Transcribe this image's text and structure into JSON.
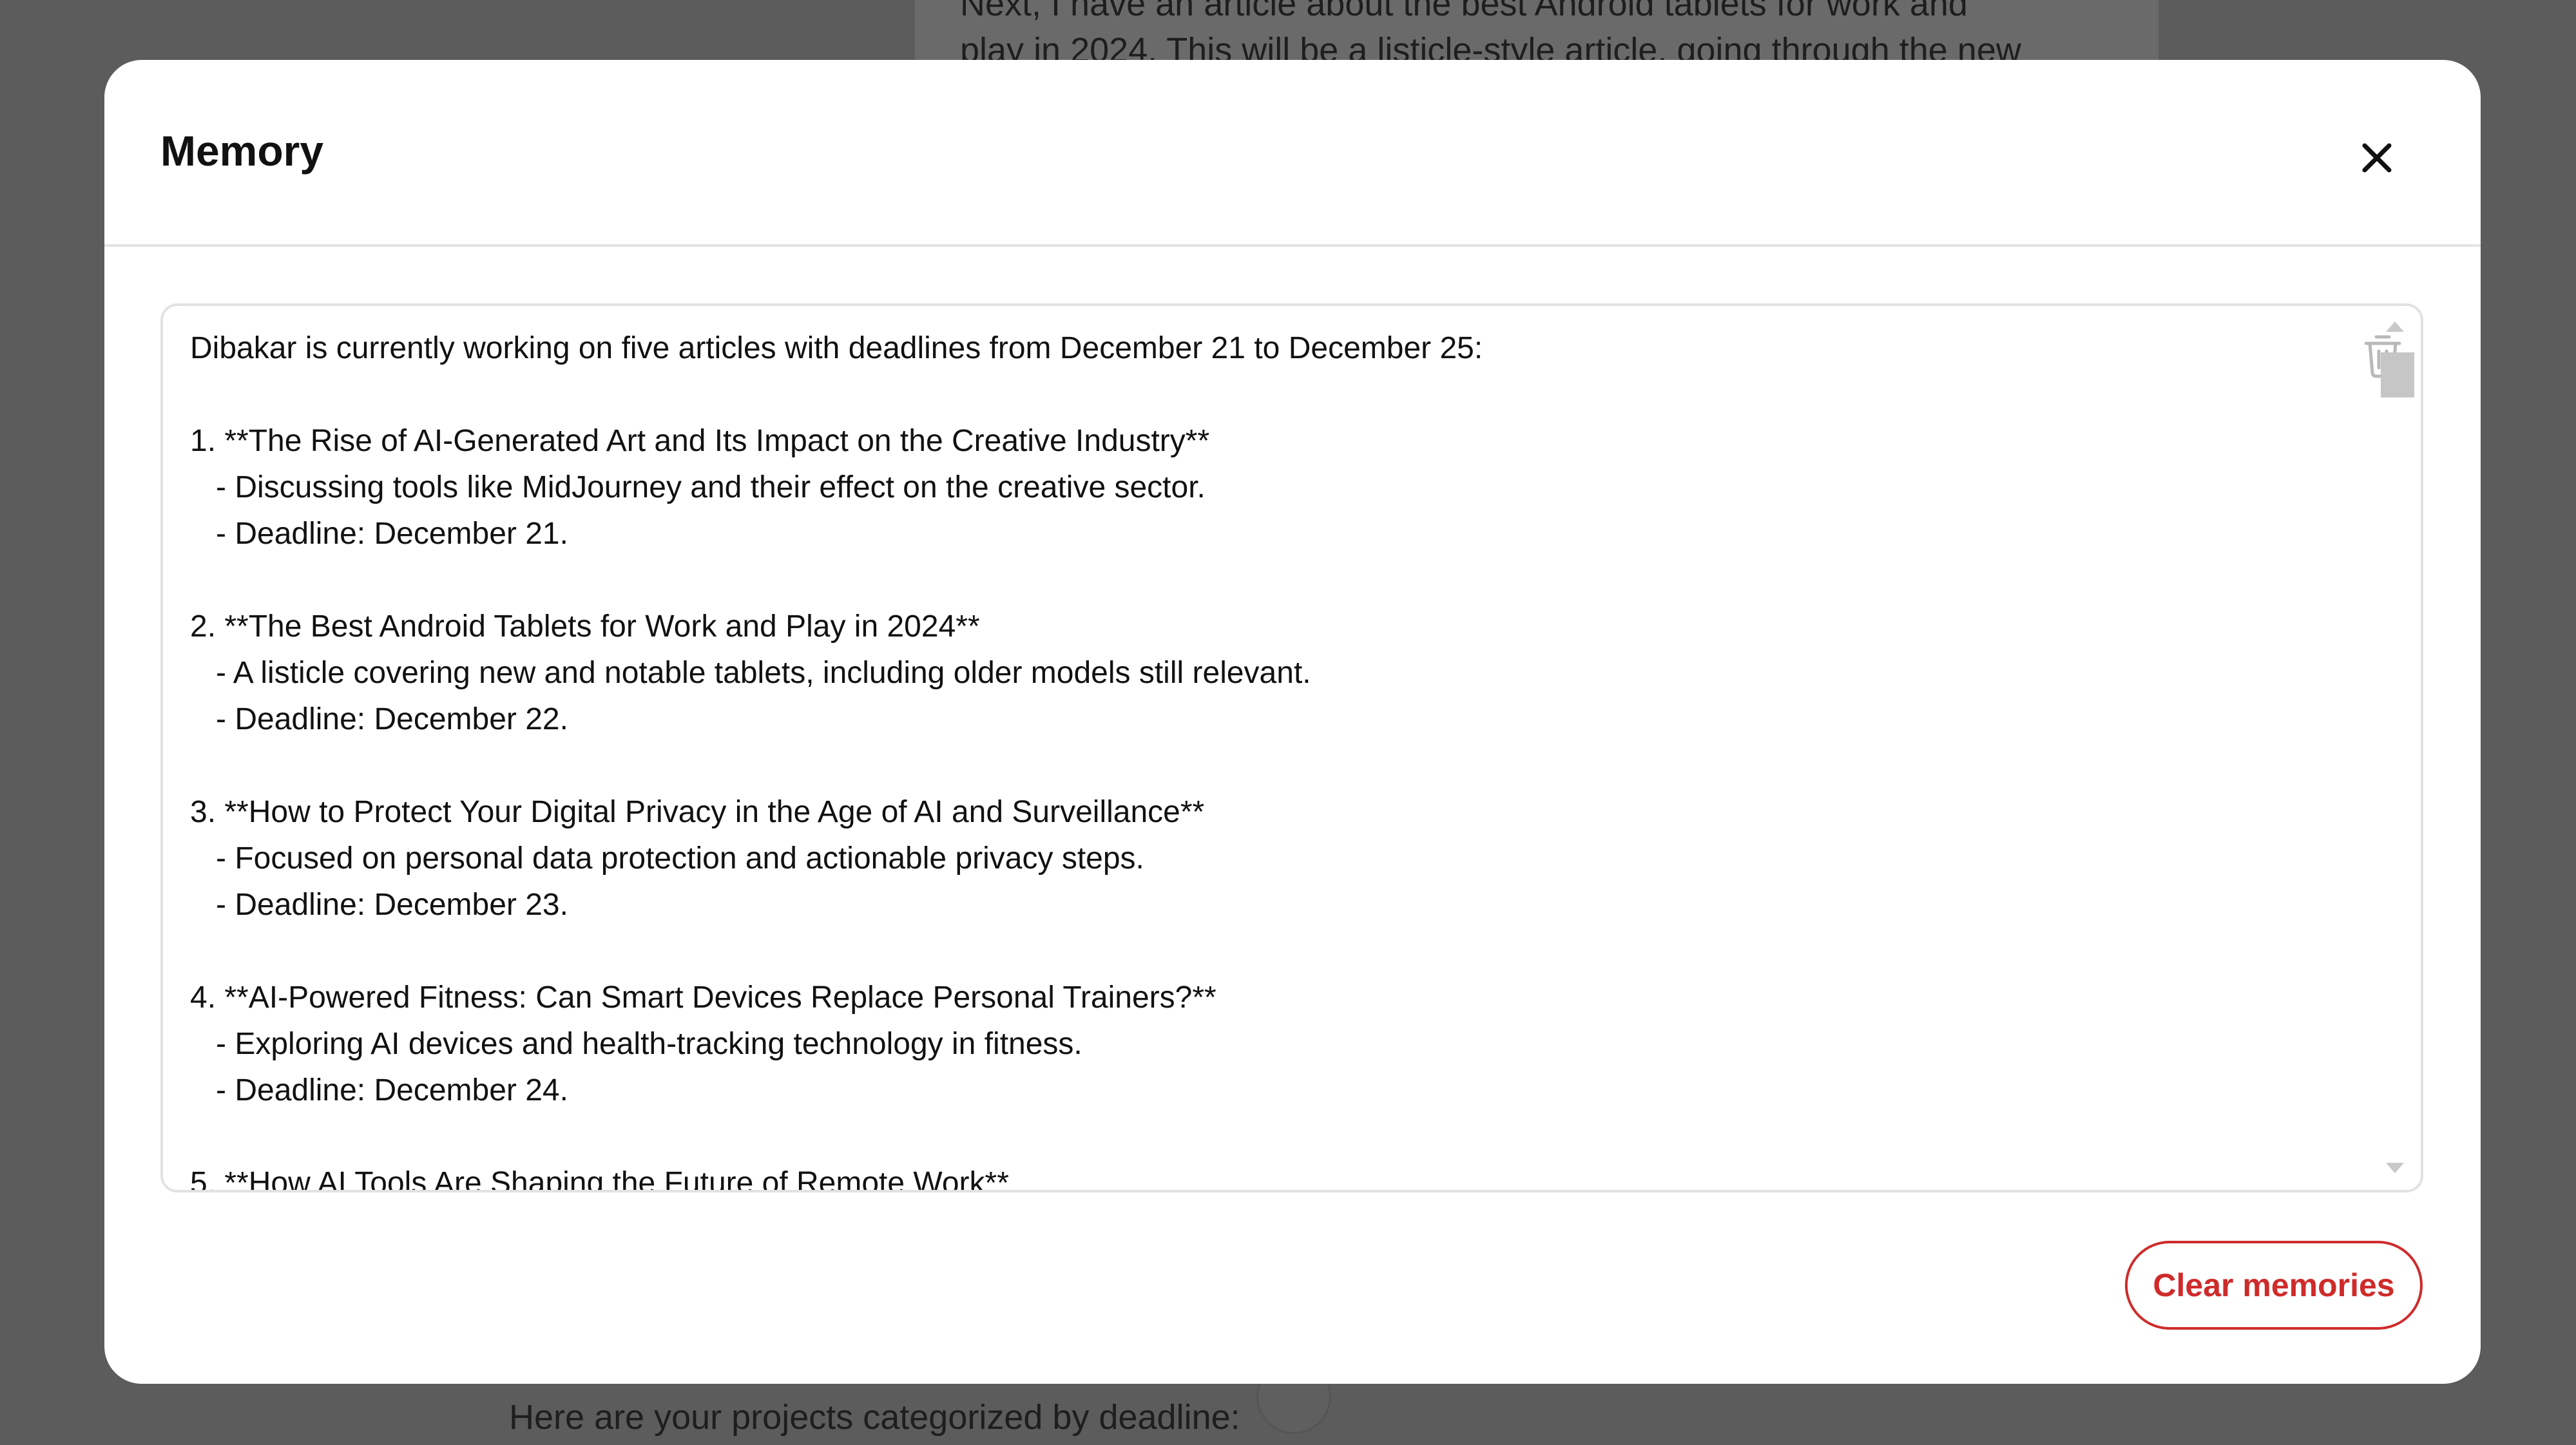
{
  "background": {
    "top_text": "Next, I have an article about the best Android tablets for work and\nplay in 2024. This will be a listicle-style article, going through the new",
    "bottom_text": "Here are your projects categorized by deadline:"
  },
  "modal": {
    "title": "Memory",
    "close_icon": "close-icon",
    "memory_text": "Dibakar is currently working on five articles with deadlines from December 21 to December 25:\n\n1. **The Rise of AI-Generated Art and Its Impact on the Creative Industry**\n   - Discussing tools like MidJourney and their effect on the creative sector.\n   - Deadline: December 21.\n\n2. **The Best Android Tablets for Work and Play in 2024**\n   - A listicle covering new and notable tablets, including older models still relevant.\n   - Deadline: December 22.\n\n3. **How to Protect Your Digital Privacy in the Age of AI and Surveillance**\n   - Focused on personal data protection and actionable privacy steps.\n   - Deadline: December 23.\n\n4. **AI-Powered Fitness: Can Smart Devices Replace Personal Trainers?**\n   - Exploring AI devices and health-tracking technology in fitness.\n   - Deadline: December 24.\n\n5. **How AI Tools Are Shaping the Future of Remote Work**",
    "delete_icon": "trash-icon",
    "clear_button_label": "Clear memories"
  },
  "colors": {
    "backdrop": "#5c5c5c",
    "modal_bg": "#ffffff",
    "danger": "#cf2b2b"
  }
}
